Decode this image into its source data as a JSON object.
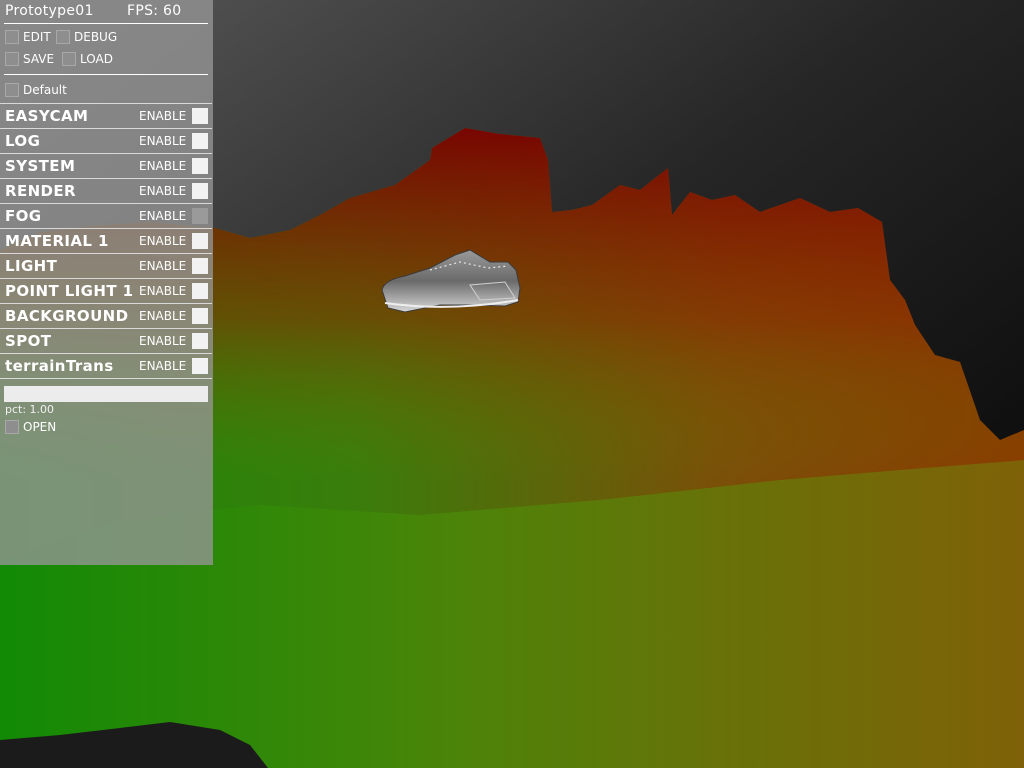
{
  "app": {
    "title": "Prototype01",
    "fps_label": "FPS:  60"
  },
  "toggles": {
    "edit": "EDIT",
    "debug": "DEBUG",
    "save": "SAVE",
    "load": "LOAD",
    "preset": "Default"
  },
  "modules": [
    {
      "name": "EASYCAM",
      "enable": "ENABLE",
      "enabled": true
    },
    {
      "name": "LOG",
      "enable": "ENABLE",
      "enabled": true
    },
    {
      "name": "SYSTEM",
      "enable": "ENABLE",
      "enabled": true
    },
    {
      "name": "RENDER",
      "enable": "ENABLE",
      "enabled": true
    },
    {
      "name": "FOG",
      "enable": "ENABLE",
      "enabled": false
    },
    {
      "name": "MATERIAL  1",
      "enable": "ENABLE",
      "enabled": true
    },
    {
      "name": "LIGHT",
      "enable": "ENABLE",
      "enabled": true
    },
    {
      "name": "POINT  LIGHT  1",
      "enable": "ENABLE",
      "enabled": true
    },
    {
      "name": "BACKGROUND",
      "enable": "ENABLE",
      "enabled": true
    },
    {
      "name": "SPOT",
      "enable": "ENABLE",
      "enabled": true
    },
    {
      "name": "terrainTrans",
      "enable": "ENABLE",
      "enabled": true
    }
  ],
  "pct_slider": {
    "label": "pct:  1.00",
    "value": 1.0
  },
  "open_toggle": {
    "label": "OPEN"
  },
  "colors": {
    "terrain_green": "#1a8a0a",
    "terrain_red": "#8b0000",
    "terrain_olive": "#7a7010",
    "sky_top": "#5a5a5a",
    "panel_bg": "#969696"
  }
}
